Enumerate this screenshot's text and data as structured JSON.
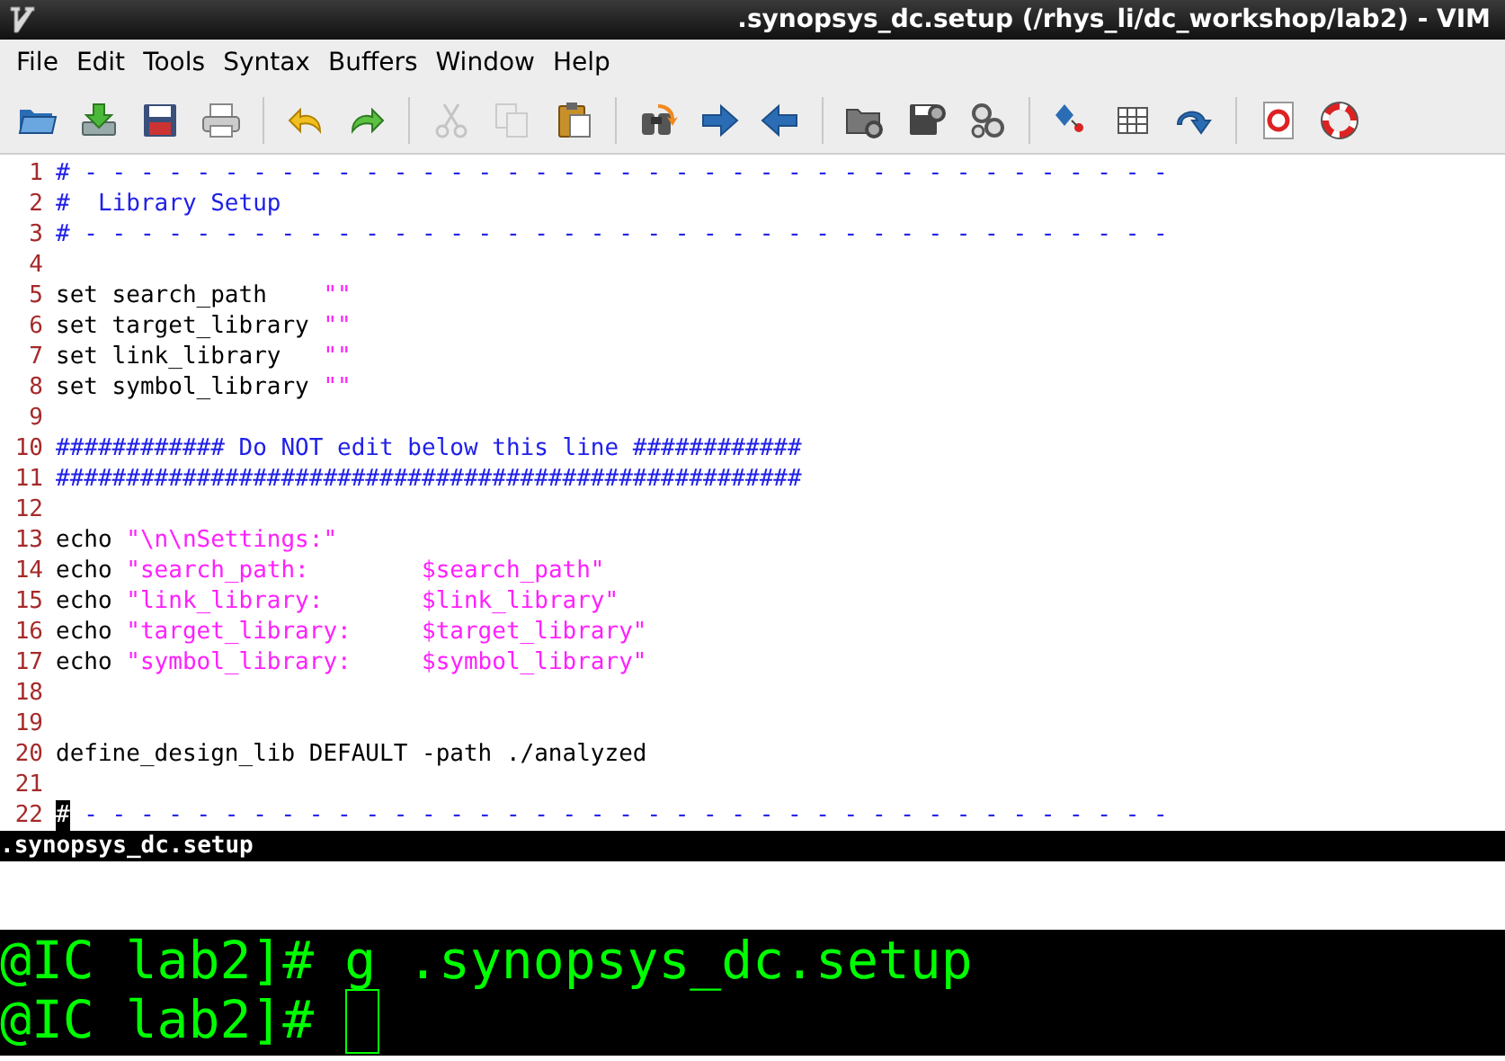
{
  "window": {
    "title": ".synopsys_dc.setup (/rhys_li/dc_workshop/lab2) - VIM"
  },
  "menu": [
    "File",
    "Edit",
    "Tools",
    "Syntax",
    "Buffers",
    "Window",
    "Help"
  ],
  "toolbar": [
    {
      "kind": "open",
      "disabled": false
    },
    {
      "kind": "download",
      "disabled": false
    },
    {
      "kind": "floppy",
      "disabled": false
    },
    {
      "kind": "print",
      "disabled": false
    },
    {
      "kind": "separator"
    },
    {
      "kind": "undo",
      "disabled": false
    },
    {
      "kind": "redo",
      "disabled": false
    },
    {
      "kind": "separator"
    },
    {
      "kind": "cut",
      "disabled": true
    },
    {
      "kind": "copy",
      "disabled": true
    },
    {
      "kind": "paste",
      "disabled": false
    },
    {
      "kind": "separator"
    },
    {
      "kind": "binoculars",
      "disabled": false
    },
    {
      "kind": "arrow-right",
      "disabled": false
    },
    {
      "kind": "arrow-left",
      "disabled": false
    },
    {
      "kind": "separator"
    },
    {
      "kind": "folder-gear",
      "disabled": false
    },
    {
      "kind": "floppy-gear",
      "disabled": false
    },
    {
      "kind": "gears",
      "disabled": false
    },
    {
      "kind": "separator"
    },
    {
      "kind": "diamond",
      "disabled": false
    },
    {
      "kind": "table",
      "disabled": false
    },
    {
      "kind": "curved-arrow",
      "disabled": false
    },
    {
      "kind": "separator"
    },
    {
      "kind": "document",
      "disabled": false
    },
    {
      "kind": "lifebuoy",
      "disabled": false
    }
  ],
  "editor": {
    "lines": [
      {
        "number": "1",
        "segments": [
          {
            "kind": "comment",
            "text": "# - - - - - - - - - - - - - - - - - - - - - - - - - - - - - - - - - - - - - - -"
          }
        ]
      },
      {
        "number": "2",
        "segments": [
          {
            "kind": "comment",
            "text": "#  Library Setup"
          }
        ]
      },
      {
        "number": "3",
        "segments": [
          {
            "kind": "comment",
            "text": "# - - - - - - - - - - - - - - - - - - - - - - - - - - - - - - - - - - - - - - -"
          }
        ]
      },
      {
        "number": "4"
      },
      {
        "number": "5",
        "segments": [
          {
            "kind": "normal",
            "text": "set search_path    "
          },
          {
            "kind": "string",
            "text": "\"\""
          }
        ]
      },
      {
        "number": "6",
        "segments": [
          {
            "kind": "normal",
            "text": "set target_library "
          },
          {
            "kind": "string",
            "text": "\"\""
          }
        ]
      },
      {
        "number": "7",
        "segments": [
          {
            "kind": "normal",
            "text": "set link_library   "
          },
          {
            "kind": "string",
            "text": "\"\""
          }
        ]
      },
      {
        "number": "8",
        "segments": [
          {
            "kind": "normal",
            "text": "set symbol_library "
          },
          {
            "kind": "string",
            "text": "\"\""
          }
        ]
      },
      {
        "number": "9"
      },
      {
        "number": "10",
        "segments": [
          {
            "kind": "comment",
            "text": "############ Do NOT edit below this line ############"
          }
        ]
      },
      {
        "number": "11",
        "segments": [
          {
            "kind": "comment",
            "text": "#####################################################"
          }
        ]
      },
      {
        "number": "12"
      },
      {
        "number": "13",
        "segments": [
          {
            "kind": "normal",
            "text": "echo "
          },
          {
            "kind": "string",
            "text": "\"\\n\\nSettings:\""
          }
        ]
      },
      {
        "number": "14",
        "segments": [
          {
            "kind": "normal",
            "text": "echo "
          },
          {
            "kind": "string",
            "text": "\"search_path:        $search_path\""
          }
        ]
      },
      {
        "number": "15",
        "segments": [
          {
            "kind": "normal",
            "text": "echo "
          },
          {
            "kind": "string",
            "text": "\"link_library:       $link_library\""
          }
        ]
      },
      {
        "number": "16",
        "segments": [
          {
            "kind": "normal",
            "text": "echo "
          },
          {
            "kind": "string",
            "text": "\"target_library:     $target_library\""
          }
        ]
      },
      {
        "number": "17",
        "segments": [
          {
            "kind": "normal",
            "text": "echo "
          },
          {
            "kind": "string",
            "text": "\"symbol_library:     $symbol_library\""
          }
        ]
      },
      {
        "number": "18"
      },
      {
        "number": "19"
      },
      {
        "number": "20",
        "segments": [
          {
            "kind": "normal",
            "text": "define_design_lib DEFAULT -path ./analyzed"
          }
        ]
      },
      {
        "number": "21"
      },
      {
        "number": "22",
        "segments": [
          {
            "kind": "cursor",
            "text": "#"
          },
          {
            "kind": "comment",
            "text": " - - - - - - - - - - - - - - - - - - - - - - - - - - - - - - - - - - - - - - -"
          }
        ]
      }
    ]
  },
  "status_line": {
    "text": ".synopsys_dc.setup"
  },
  "terminal": {
    "lines": [
      {
        "prompt": "@IC lab2]#",
        "command": "g .synopsys_dc.setup",
        "cursor": false
      },
      {
        "prompt": "@IC lab2]#",
        "cursor": true
      }
    ]
  }
}
